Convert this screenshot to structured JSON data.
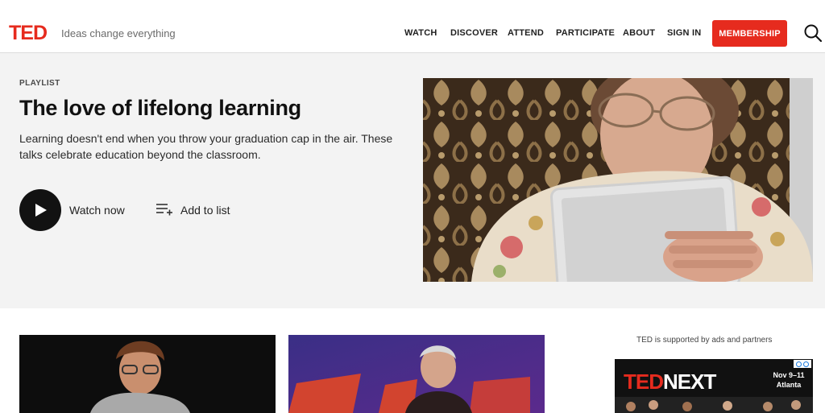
{
  "header": {
    "logo": "TED",
    "tagline": "Ideas change everything",
    "nav": [
      "WATCH",
      "DISCOVER",
      "ATTEND",
      "PARTICIPATE",
      "ABOUT",
      "SIGN IN"
    ],
    "membership_label": "MEMBERSHIP",
    "search_icon": "search-icon"
  },
  "hero": {
    "eyebrow": "PLAYLIST",
    "title": "The love of lifelong learning",
    "description": "Learning doesn't end when you throw your graduation cap in the air. These talks celebrate education beyond the classroom.",
    "watch_label": "Watch now",
    "add_label": "Add to list",
    "image_alt": "Elderly woman reading on a tablet"
  },
  "ad": {
    "note": "TED is supported by ads and partners",
    "brand_ted": "TED",
    "brand_next": "NEXT",
    "date_line1": "Nov 9–11",
    "date_line2": "Atlanta"
  },
  "colors": {
    "brand_red": "#e62b1e",
    "hero_bg": "#f3f3f3"
  }
}
